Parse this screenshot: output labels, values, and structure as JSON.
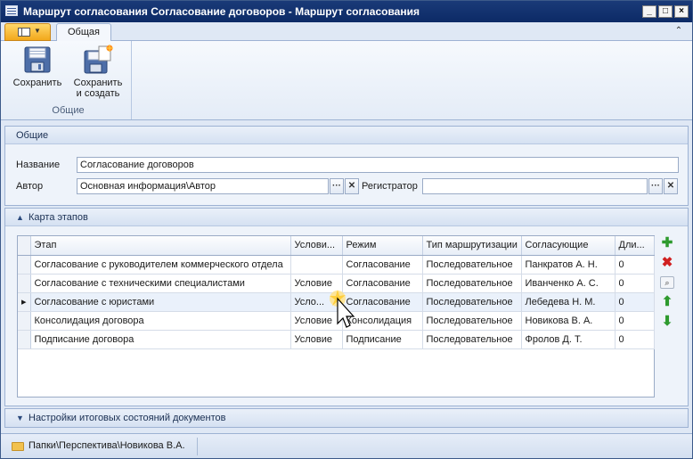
{
  "window": {
    "title": "Маршрут согласования Согласование договоров - Маршрут согласования",
    "minimize": "_",
    "maximize": "□",
    "close": "×"
  },
  "ribbon": {
    "tab_label": "Общая",
    "collapse_glyph": "⌃",
    "save_label": "Сохранить",
    "save_create_label_line1": "Сохранить",
    "save_create_label_line2": "и создать",
    "group_label": "Общие"
  },
  "general": {
    "header": "Общие",
    "name_label": "Название",
    "name_value": "Согласование договоров",
    "author_label": "Автор",
    "author_value": "Основная информация\\Автор",
    "registrar_label": "Регистратор",
    "registrar_value": "",
    "ellipsis": "···",
    "clear": "✕"
  },
  "stages": {
    "header": "Карта этапов",
    "columns": [
      "Этап",
      "Услови...",
      "Режим",
      "Тип маршрутизации",
      "Согласующие",
      "Дли..."
    ],
    "rows": [
      [
        "Согласование с руководителем коммерческого отдела",
        "",
        "Согласование",
        "Последовательное",
        "Панкратов А. Н.",
        "0"
      ],
      [
        "Согласование с техническими специалистами",
        "Условие",
        "Согласование",
        "Последовательное",
        "Иванченко А. С.",
        "0"
      ],
      [
        "Согласование с юристами",
        "Усло...",
        "Согласование",
        "Последовательное",
        "Лебедева Н. М.",
        "0"
      ],
      [
        "Консолидация договора",
        "Условие",
        "Консолидация",
        "Последовательное",
        "Новикова В. А.",
        "0"
      ],
      [
        "Подписание договора",
        "Условие",
        "Подписание",
        "Последовательное",
        "Фролов Д. Т.",
        "0"
      ]
    ],
    "current_row_marker": "▸",
    "add_glyph": "✚",
    "delete_glyph": "✖",
    "find_glyph": "⌕",
    "up_glyph": "⬆",
    "down_glyph": "⬇"
  },
  "final_states": {
    "header": "Настройки итоговых состояний документов"
  },
  "statusbar": {
    "path": "Папки\\Перспектива\\Новикова В.А."
  },
  "colors": {
    "title_bar": "#0c2a66",
    "accent": "#f2a81b",
    "panel_bg": "#eef3fa"
  }
}
